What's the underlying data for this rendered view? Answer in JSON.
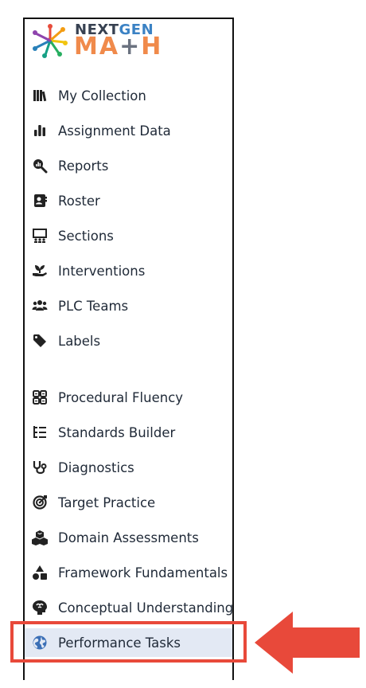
{
  "logo": {
    "top_word_a": "NEXT",
    "top_word_b": "GEN",
    "bottom_word_a": "M",
    "bottom_word_b": "A",
    "bottom_word_c": "+",
    "bottom_word_d": "H"
  },
  "nav": {
    "items": [
      {
        "label": "My Collection",
        "icon": "collection-icon"
      },
      {
        "label": "Assignment Data",
        "icon": "bar-chart-icon"
      },
      {
        "label": "Reports",
        "icon": "report-search-icon"
      },
      {
        "label": "Roster",
        "icon": "roster-card-icon"
      },
      {
        "label": "Sections",
        "icon": "sections-icon"
      },
      {
        "label": "Interventions",
        "icon": "seedling-hand-icon"
      },
      {
        "label": "PLC Teams",
        "icon": "people-group-icon"
      },
      {
        "label": "Labels",
        "icon": "tag-icon"
      }
    ],
    "items2": [
      {
        "label": "Procedural Fluency",
        "icon": "grid-icon"
      },
      {
        "label": "Standards Builder",
        "icon": "list-tree-icon"
      },
      {
        "label": "Diagnostics",
        "icon": "stethoscope-icon"
      },
      {
        "label": "Target Practice",
        "icon": "target-icon"
      },
      {
        "label": "Domain Assessments",
        "icon": "cubes-icon"
      },
      {
        "label": "Framework Fundamentals",
        "icon": "shapes-icon"
      },
      {
        "label": "Conceptual Understanding",
        "icon": "brain-icon"
      },
      {
        "label": "Performance Tasks",
        "icon": "globe-icon",
        "active": true
      }
    ]
  },
  "colors": {
    "highlight": "#e8493a",
    "active_bg": "#e3e9f4",
    "icon": "#222222",
    "globe": "#3b6fb6"
  }
}
